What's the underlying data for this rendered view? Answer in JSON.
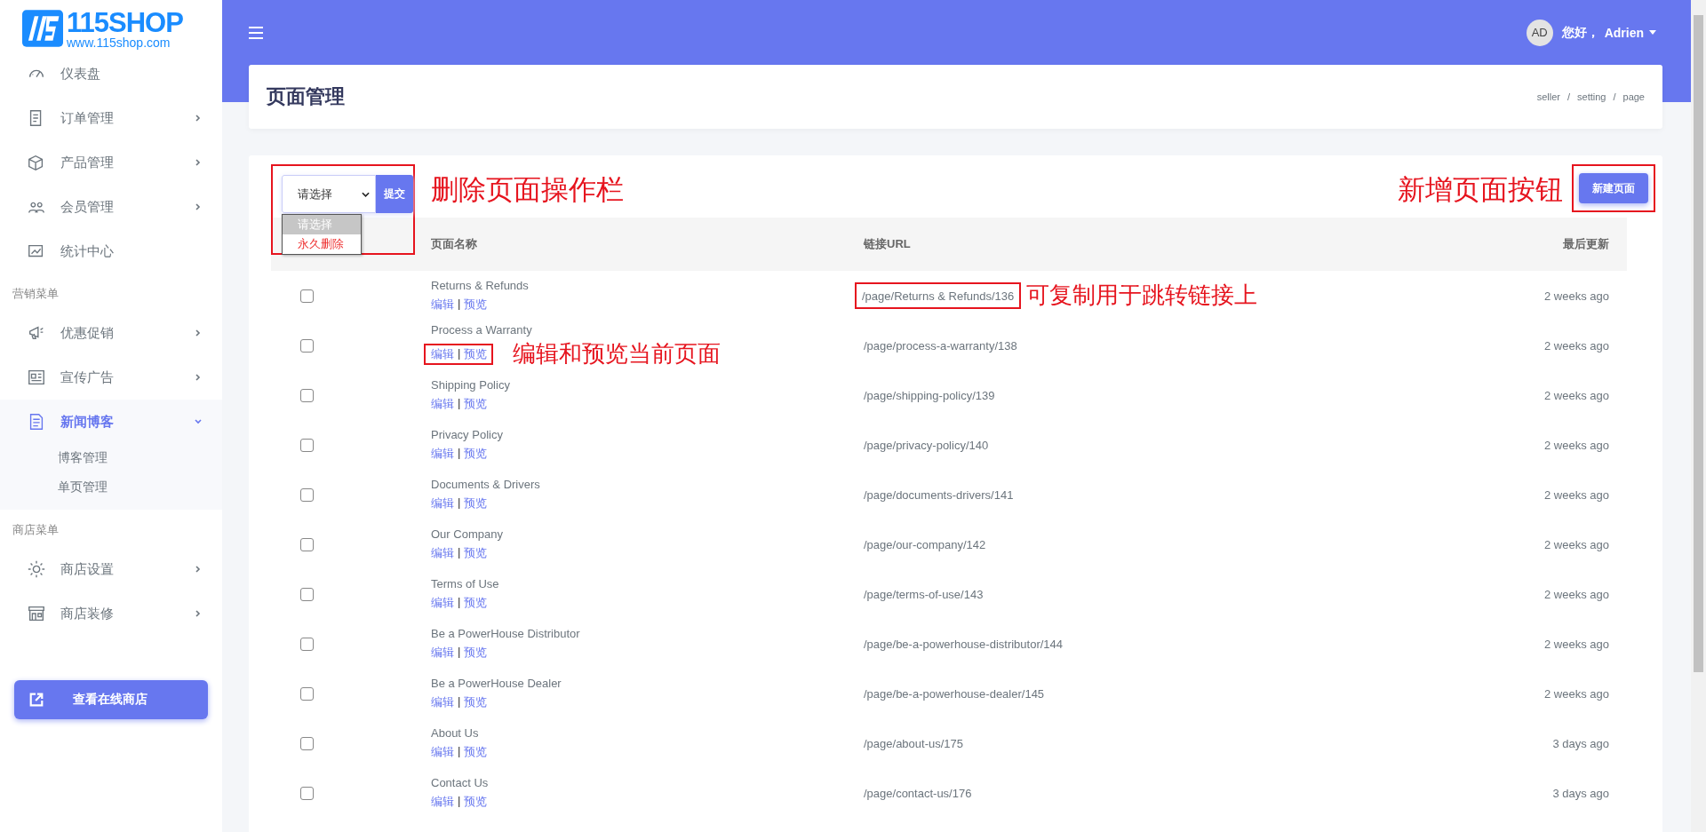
{
  "logo": {
    "name": "115SHOP",
    "url": "www.115shop.com"
  },
  "sidebar": {
    "sections": [
      {
        "items": [
          {
            "label": "仪表盘",
            "kind": "link",
            "selected": false
          },
          {
            "label": "订单管理",
            "kind": "menu",
            "selected": false,
            "expanded": false
          },
          {
            "label": "产品管理",
            "kind": "menu",
            "selected": false,
            "expanded": false
          },
          {
            "label": "会员管理",
            "kind": "menu",
            "selected": false,
            "expanded": false
          },
          {
            "label": "统计中心",
            "kind": "link",
            "selected": false
          }
        ]
      },
      {
        "heading": "营销菜单",
        "items": [
          {
            "label": "优惠促销",
            "kind": "menu",
            "selected": false,
            "expanded": false
          },
          {
            "label": "宣传广告",
            "kind": "menu",
            "selected": false,
            "expanded": false
          },
          {
            "label": "新闻博客",
            "kind": "menu",
            "selected": true,
            "expanded": true,
            "children": [
              "博客管理",
              "单页管理"
            ]
          }
        ]
      },
      {
        "heading": "商店菜单",
        "items": [
          {
            "label": "商店设置",
            "kind": "menu",
            "selected": false,
            "expanded": false
          },
          {
            "label": "商店装修",
            "kind": "menu",
            "selected": false,
            "expanded": false
          }
        ]
      }
    ],
    "button": "查看在线商店"
  },
  "topbar": {
    "avatar": "AD",
    "greeting": "您好，",
    "user": "Adrien"
  },
  "page": {
    "title": "页面管理",
    "breadcrumb": [
      "seller",
      "setting",
      "page"
    ],
    "breadcrumb_separator": "/"
  },
  "toolbar": {
    "select": "请选择",
    "submit": "提交",
    "options": [
      {
        "label": "请选择",
        "selected": true
      },
      {
        "label": "永久删除",
        "selected": false
      }
    ],
    "note": "删除页面操作栏",
    "new_button": "新建页面",
    "new_button_note": "新增页面按钮"
  },
  "table": {
    "columns": [
      "页面名称",
      "链接URL",
      "最后更新"
    ],
    "rows": [
      {
        "name": "Returns & Refunds",
        "edit": "编辑",
        "separator": "|",
        "preview": "预览",
        "url": "/page/Returns & Refunds/136",
        "updated": "2 weeks ago",
        "checked": false,
        "url_note": "可复制用于跳转链接上"
      },
      {
        "name": "Process a Warranty",
        "edit": "编辑",
        "separator": "|",
        "preview": "预览",
        "url": "/page/process-a-warranty/138",
        "updated": "2 weeks ago",
        "checked": false,
        "actions_note": "编辑和预览当前页面"
      },
      {
        "name": "Shipping Policy",
        "edit": "编辑",
        "separator": "|",
        "preview": "预览",
        "url": "/page/shipping-policy/139",
        "updated": "2 weeks ago",
        "checked": false
      },
      {
        "name": "Privacy Policy",
        "edit": "编辑",
        "separator": "|",
        "preview": "预览",
        "url": "/page/privacy-policy/140",
        "updated": "2 weeks ago",
        "checked": false
      },
      {
        "name": "Documents & Drivers",
        "edit": "编辑",
        "separator": "|",
        "preview": "预览",
        "url": "/page/documents-drivers/141",
        "updated": "2 weeks ago",
        "checked": false
      },
      {
        "name": "Our Company",
        "edit": "编辑",
        "separator": "|",
        "preview": "预览",
        "url": "/page/our-company/142",
        "updated": "2 weeks ago",
        "checked": false
      },
      {
        "name": "Terms of Use",
        "edit": "编辑",
        "separator": "|",
        "preview": "预览",
        "url": "/page/terms-of-use/143",
        "updated": "2 weeks ago",
        "checked": false
      },
      {
        "name": "Be a PowerHouse Distributor",
        "edit": "编辑",
        "separator": "|",
        "preview": "预览",
        "url": "/page/be-a-powerhouse-distributor/144",
        "updated": "2 weeks ago",
        "checked": false
      },
      {
        "name": "Be a PowerHouse Dealer",
        "edit": "编辑",
        "separator": "|",
        "preview": "预览",
        "url": "/page/be-a-powerhouse-dealer/145",
        "updated": "2 weeks ago",
        "checked": false
      },
      {
        "name": "About Us",
        "edit": "编辑",
        "separator": "|",
        "preview": "预览",
        "url": "/page/about-us/175",
        "updated": "3 days ago",
        "checked": false
      },
      {
        "name": "Contact Us",
        "edit": "编辑",
        "separator": "|",
        "preview": "预览",
        "url": "/page/contact-us/176",
        "updated": "3 days ago",
        "checked": false
      }
    ]
  }
}
